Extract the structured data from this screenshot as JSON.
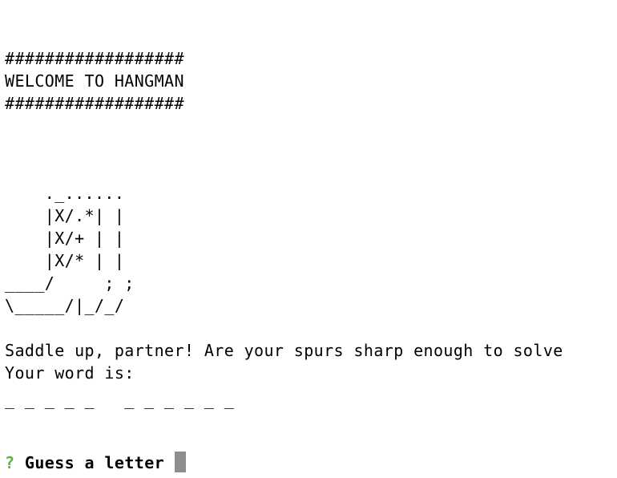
{
  "banner": {
    "border_top": "##################",
    "title": "WELCOME TO HANGMAN",
    "border_bottom": "##################"
  },
  "art": [
    "    ._......",
    "    |X/.*| |",
    "    |X/+ | |",
    "    |X/* | |",
    "____/     ; ;",
    "\\_____/|_/_/"
  ],
  "messages": {
    "intro": "Saddle up, partner! Are your spurs sharp enough to solve",
    "word_label": "Your word is:",
    "word_blanks": "_ _ _ _ _   _ _ _ _ _ _"
  },
  "prompt": {
    "mark": "?",
    "question": "Guess a letter",
    "input_value": ""
  },
  "colors": {
    "prompt_mark": "#5fb33f",
    "cursor": "#8e8e8e"
  }
}
